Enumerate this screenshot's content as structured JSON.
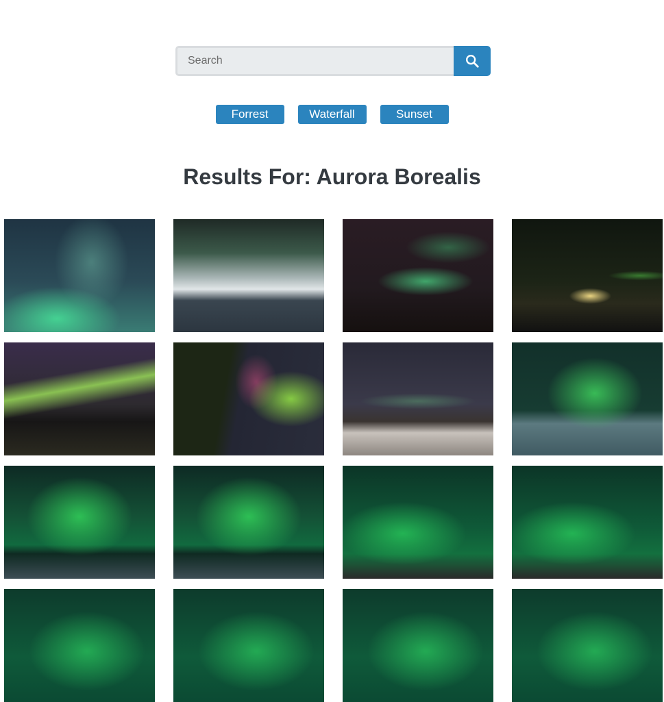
{
  "search": {
    "placeholder": "Search",
    "button_icon": "search-icon"
  },
  "tags": [
    "Forrest",
    "Waterfall",
    "Sunset"
  ],
  "results": {
    "title": "Results For: Aurora Borealis"
  },
  "colors": {
    "accent": "#2b84be",
    "input_bg": "#e9ecee",
    "title": "#343a40"
  }
}
